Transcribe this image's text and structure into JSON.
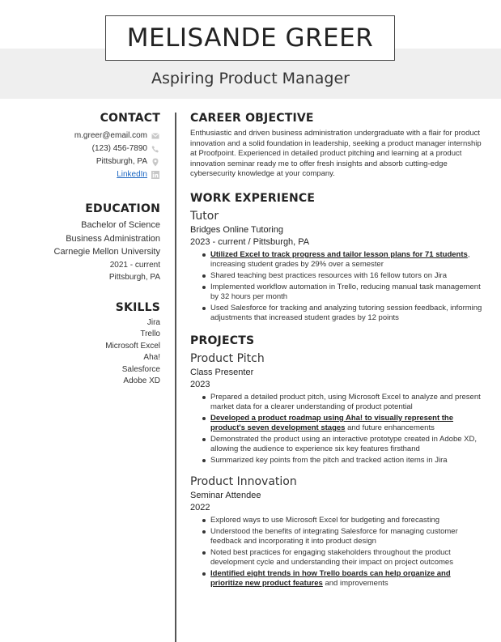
{
  "header": {
    "name": "MELISANDE GREER",
    "title": "Aspiring Product Manager"
  },
  "contact": {
    "heading": "CONTACT",
    "email": "m.greer@email.com",
    "phone": "(123) 456-7890",
    "location": "Pittsburgh, PA",
    "linkedin": "LinkedIn"
  },
  "education": {
    "heading": "EDUCATION",
    "degree": "Bachelor of Science",
    "major": "Business Administration",
    "school": "Carnegie Mellon University",
    "dates": "2021 - current",
    "location": "Pittsburgh, PA"
  },
  "skills": {
    "heading": "SKILLS",
    "items": [
      "Jira",
      "Trello",
      "Microsoft Excel",
      "Aha!",
      "Salesforce",
      "Adobe XD"
    ]
  },
  "objective": {
    "heading": "CAREER OBJECTIVE",
    "text": "Enthusiastic and driven business administration undergraduate with a flair for product innovation and a solid foundation in leadership, seeking a product manager internship at Proofpoint. Experienced in detailed product pitching and learning at a product innovation seminar ready me to offer fresh insights and absorb cutting-edge cybersecurity knowledge at your company."
  },
  "work": {
    "heading": "WORK EXPERIENCE",
    "role": "Tutor",
    "org": "Bridges Online Tutoring",
    "date": "2023 - current  /  Pittsburgh, PA",
    "bullets": [
      {
        "hl": "Utilized Excel to track progress and tailor lesson plans for 71 students",
        "rest": ", increasing student grades by 29% over a semester"
      },
      {
        "hl": "",
        "rest": "Shared teaching best practices resources with 16 fellow tutors on Jira"
      },
      {
        "hl": "",
        "rest": "Implemented workflow automation in Trello, reducing manual task management by 32 hours per month"
      },
      {
        "hl": "",
        "rest": "Used Salesforce for tracking and analyzing tutoring session feedback, informing adjustments that increased student grades by 12 points"
      }
    ]
  },
  "projects": {
    "heading": "PROJECTS",
    "items": [
      {
        "title": "Product Pitch",
        "role": "Class Presenter",
        "year": "2023",
        "bullets": [
          {
            "hl": "",
            "rest": "Prepared a detailed product pitch, using Microsoft Excel to analyze and present market data for a clearer understanding of product potential"
          },
          {
            "hl": "Developed a product roadmap using Aha! to visually represent the product's seven development stages",
            "rest": " and future enhancements"
          },
          {
            "hl": "",
            "rest": "Demonstrated the product using an interactive prototype created in Adobe XD, allowing the audience to experience six key features firsthand"
          },
          {
            "hl": "",
            "rest": "Summarized key points from the pitch and tracked action items in Jira"
          }
        ]
      },
      {
        "title": "Product Innovation",
        "role": "Seminar Attendee",
        "year": "2022",
        "bullets": [
          {
            "hl": "",
            "rest": "Explored ways to use Microsoft Excel for budgeting and forecasting"
          },
          {
            "hl": "",
            "rest": "Understood the benefits of integrating Salesforce for managing customer feedback and incorporating it into product design"
          },
          {
            "hl": "",
            "rest": "Noted best practices for engaging stakeholders throughout the product development cycle and understanding their impact on project outcomes"
          },
          {
            "hl": "Identified eight trends in how Trello boards can help organize and prioritize new product features",
            "rest": " and improvements"
          }
        ]
      }
    ]
  }
}
